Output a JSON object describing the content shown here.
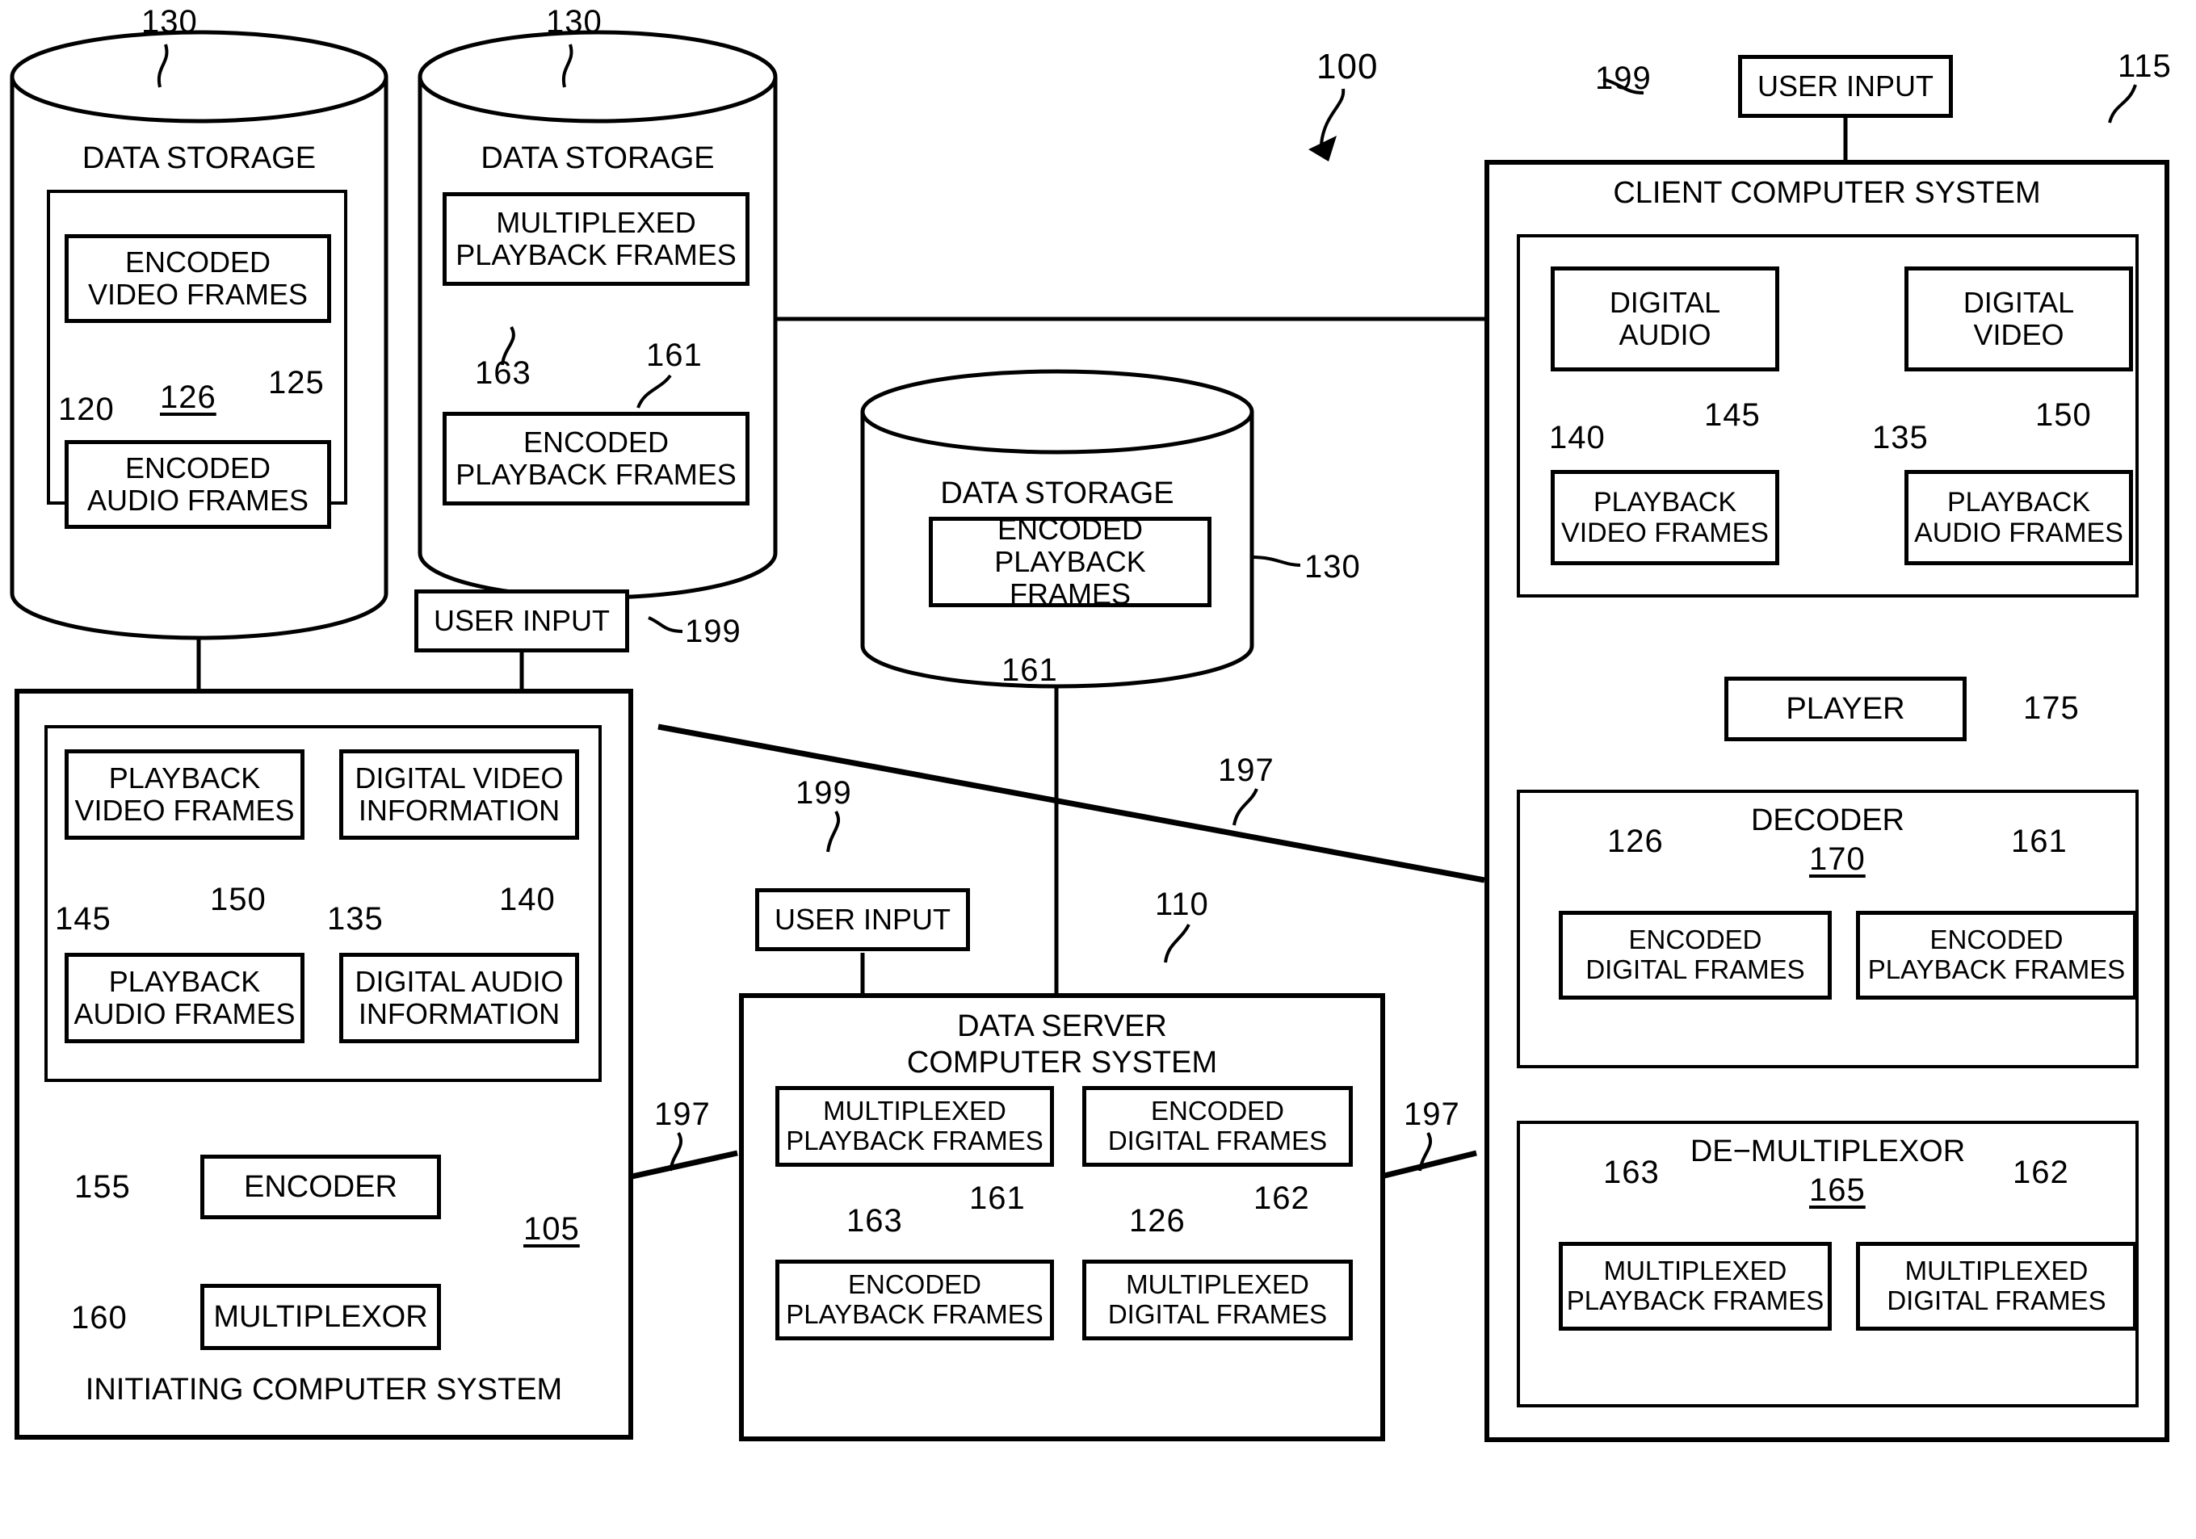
{
  "figure": {
    "system_ref": "100",
    "storages": [
      {
        "ref": "130",
        "title": "DATA STORAGE",
        "inner_group_ref": "126",
        "items": [
          {
            "label_line1": "ENCODED",
            "label_line2": "VIDEO FRAMES",
            "ref": "120"
          },
          {
            "label_line1": "ENCODED",
            "label_line2": "AUDIO FRAMES",
            "ref": "125"
          }
        ]
      },
      {
        "ref": "130",
        "title": "DATA STORAGE",
        "items": [
          {
            "label_line1": "MULTIPLEXED",
            "label_line2": "PLAYBACK  FRAMES",
            "ref": "163"
          },
          {
            "label_line1": "ENCODED",
            "label_line2": "PLAYBACK  FRAMES",
            "ref": "161"
          }
        ]
      },
      {
        "ref": "130",
        "title": "DATA STORAGE",
        "items": [
          {
            "label_line1": "ENCODED",
            "label_line2": "PLAYBACK  FRAMES",
            "ref": "161"
          }
        ]
      }
    ],
    "user_inputs": [
      {
        "label": "USER INPUT",
        "ref": "199"
      },
      {
        "label": "USER INPUT",
        "ref": "199"
      },
      {
        "label": "USER INPUT",
        "ref": "199"
      }
    ],
    "initiating_system": {
      "title": "INITIATING COMPUTER SYSTEM",
      "ref": "105",
      "frames": [
        {
          "line1": "PLAYBACK",
          "line2": "VIDEO FRAMES",
          "ref": "145"
        },
        {
          "line1": "DIGITAL VIDEO",
          "line2": "INFORMATION",
          "ref": "135"
        },
        {
          "line1": "PLAYBACK",
          "line2": "AUDIO FRAMES",
          "ref": "150"
        },
        {
          "line1": "DIGITAL AUDIO",
          "line2": "INFORMATION",
          "ref": "140"
        }
      ],
      "encoder": {
        "label": "ENCODER",
        "ref": "155"
      },
      "multiplexor": {
        "label": "MULTIPLEXOR",
        "ref": "160"
      }
    },
    "data_server": {
      "title_line1": "DATA SERVER",
      "title_line2": "COMPUTER SYSTEM",
      "ref": "110",
      "frames": [
        {
          "line1": "MULTIPLEXED",
          "line2": "PLAYBACK  FRAMES",
          "ref": "163"
        },
        {
          "line1": "ENCODED",
          "line2": "DIGITAL FRAMES",
          "ref": "126"
        },
        {
          "line1": "ENCODED",
          "line2": "PLAYBACK  FRAMES",
          "ref": "161"
        },
        {
          "line1": "MULTIPLEXED",
          "line2": "DIGITAL FRAMES",
          "ref": "162"
        }
      ]
    },
    "client_system": {
      "title": "CLIENT COMPUTER SYSTEM",
      "ref": "115",
      "media": [
        {
          "line1": "DIGITAL",
          "line2": "AUDIO",
          "ref": "140"
        },
        {
          "line1": "DIGITAL",
          "line2": "VIDEO",
          "ref": "135"
        },
        {
          "line1": "PLAYBACK",
          "line2": "VIDEO FRAMES",
          "ref": "145"
        },
        {
          "line1": "PLAYBACK",
          "line2": "AUDIO FRAMES",
          "ref": "150"
        }
      ],
      "player": {
        "label": "PLAYER",
        "ref": "175"
      },
      "decoder": {
        "title": "DECODER",
        "ref": "170",
        "frames": [
          {
            "line1": "ENCODED",
            "line2": "DIGITAL FRAMES",
            "ref": "126"
          },
          {
            "line1": "ENCODED",
            "line2": "PLAYBACK  FRAMES",
            "ref": "161"
          }
        ]
      },
      "demultiplexor": {
        "title": "DE−MULTIPLEXOR",
        "ref": "165",
        "frames": [
          {
            "line1": "MULTIPLEXED",
            "line2": "PLAYBACK  FRAMES",
            "ref": "163"
          },
          {
            "line1": "MULTIPLEXED",
            "line2": "DIGITAL FRAMES",
            "ref": "162"
          }
        ]
      }
    },
    "network_refs": [
      "197",
      "197",
      "197"
    ]
  }
}
